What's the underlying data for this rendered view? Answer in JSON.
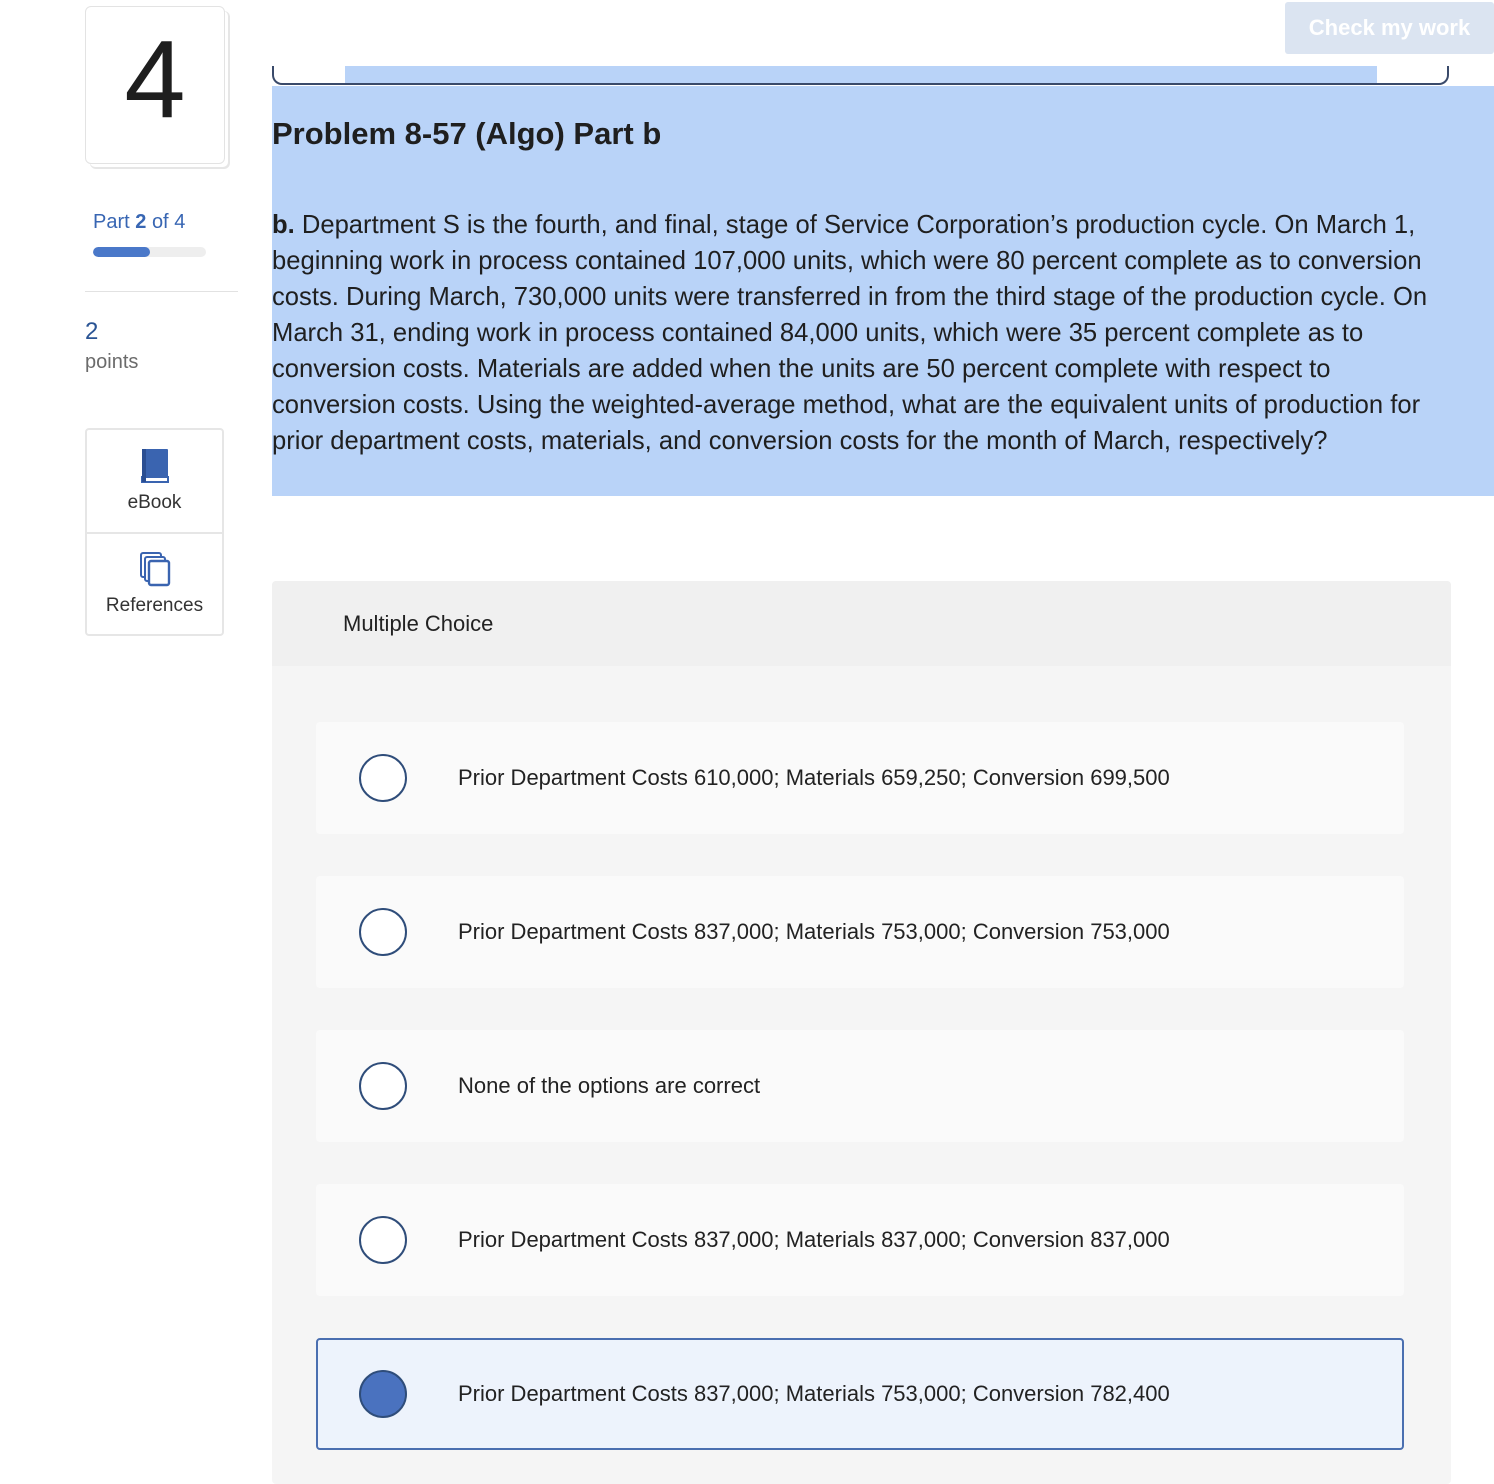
{
  "question": {
    "number": "4",
    "part_current": "2",
    "part_total": "4",
    "part_of_word": "of",
    "part_word": "Part",
    "part_progress": 0.5,
    "points_value": "2",
    "points_label": "points"
  },
  "tools": {
    "ebook_label": "eBook",
    "references_label": "References"
  },
  "header": {
    "check_label": "Check my work"
  },
  "problem": {
    "title": "Problem 8-57 (Algo) Part b",
    "part_prefix": "b.",
    "text": " Department S is the fourth, and final, stage of Service Corporation’s production cycle. On March 1, beginning work in process contained 107,000 units, which were 80 percent complete as to conversion costs. During March, 730,000 units were transferred in from the third stage of the production cycle. On March 31, ending work in process contained 84,000 units, which were 35 percent complete as to conversion costs. Materials are added when the units are 50 percent complete with respect to conversion costs. Using the weighted-average method, what are the equivalent units of production for prior department costs, materials, and conversion costs for the month of March, respectively?"
  },
  "multiple_choice": {
    "header": "Multiple Choice",
    "selected_index": 4,
    "options": [
      {
        "text": "Prior Department Costs 610,000; Materials 659,250; Conversion 699,500"
      },
      {
        "text": "Prior Department Costs 837,000; Materials 753,000; Conversion 753,000"
      },
      {
        "text": "None of the options are correct"
      },
      {
        "text": "Prior Department Costs 837,000; Materials 837,000; Conversion 837,000"
      },
      {
        "text": "Prior Department Costs 837,000; Materials 753,000; Conversion 782,400"
      }
    ]
  },
  "colors": {
    "accent": "#4a78c9",
    "highlight": "#b9d3f8",
    "selected_radio": "#4a72bf"
  }
}
